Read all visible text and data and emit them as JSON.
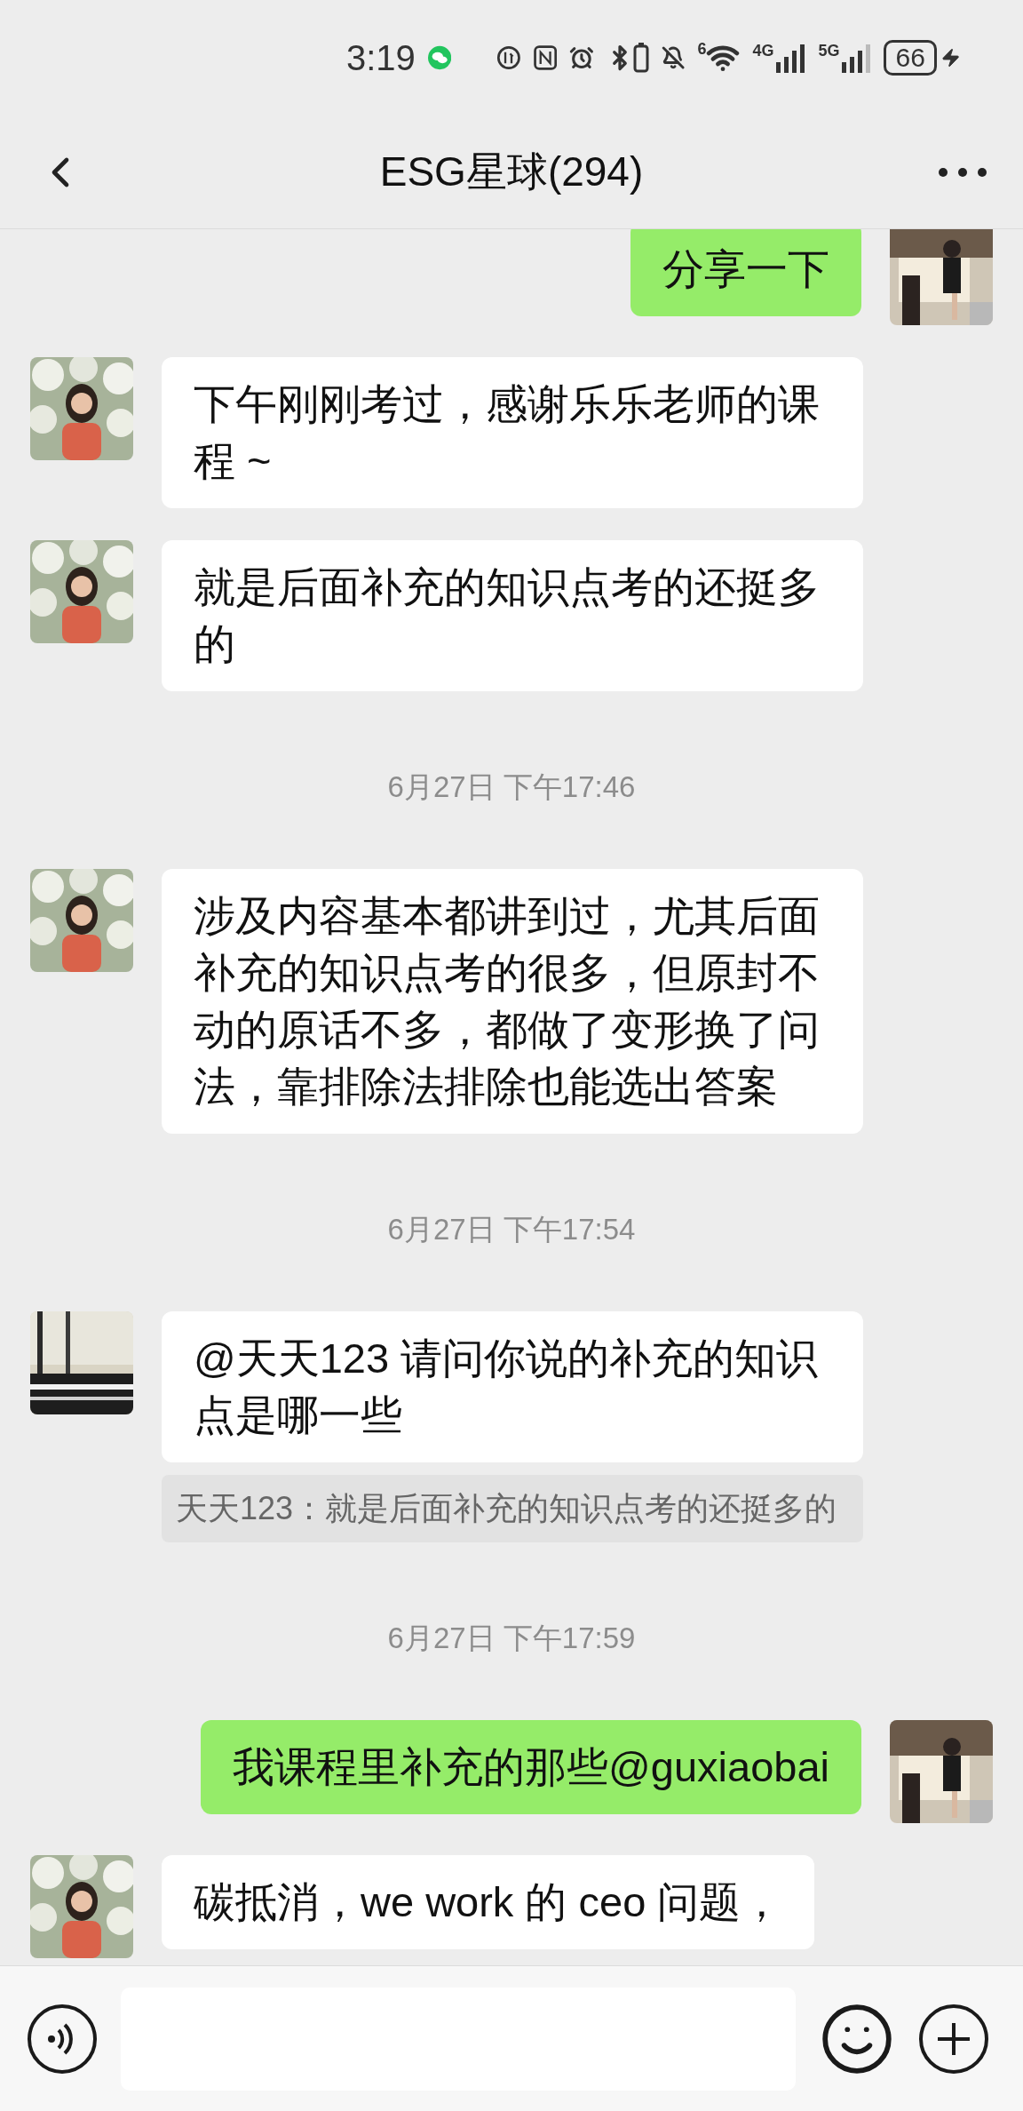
{
  "status_bar": {
    "time": "3:19",
    "wifi_label": "6",
    "network_labels": [
      "4G",
      "5G"
    ],
    "battery": "66"
  },
  "header": {
    "title": "ESG星球(294)"
  },
  "messages": [
    {
      "kind": "outgoing",
      "text": "分享一下"
    },
    {
      "kind": "incoming",
      "text": "下午刚刚考过，感谢乐乐老师的课程 ~"
    },
    {
      "kind": "incoming",
      "text": "就是后面补充的知识点考的还挺多的"
    },
    {
      "kind": "time",
      "text": "6月27日 下午17:46"
    },
    {
      "kind": "incoming",
      "text": "涉及内容基本都讲到过，尤其后面补充的知识点考的很多，但原封不动的原话不多，都做了变形换了问法，靠排除法排除也能选出答案"
    },
    {
      "kind": "time",
      "text": "6月27日 下午17:54"
    },
    {
      "kind": "incoming",
      "text": "@天天123 请问你说的补充的知识点是哪一些",
      "quote": "天天123：就是后面补充的知识点考的还挺多的"
    },
    {
      "kind": "time",
      "text": "6月27日 下午17:59"
    },
    {
      "kind": "outgoing",
      "text": "我课程里补充的那些@guxiaobai"
    },
    {
      "kind": "incoming",
      "text": "碳抵消，we work 的 ceo 问题，"
    }
  ]
}
